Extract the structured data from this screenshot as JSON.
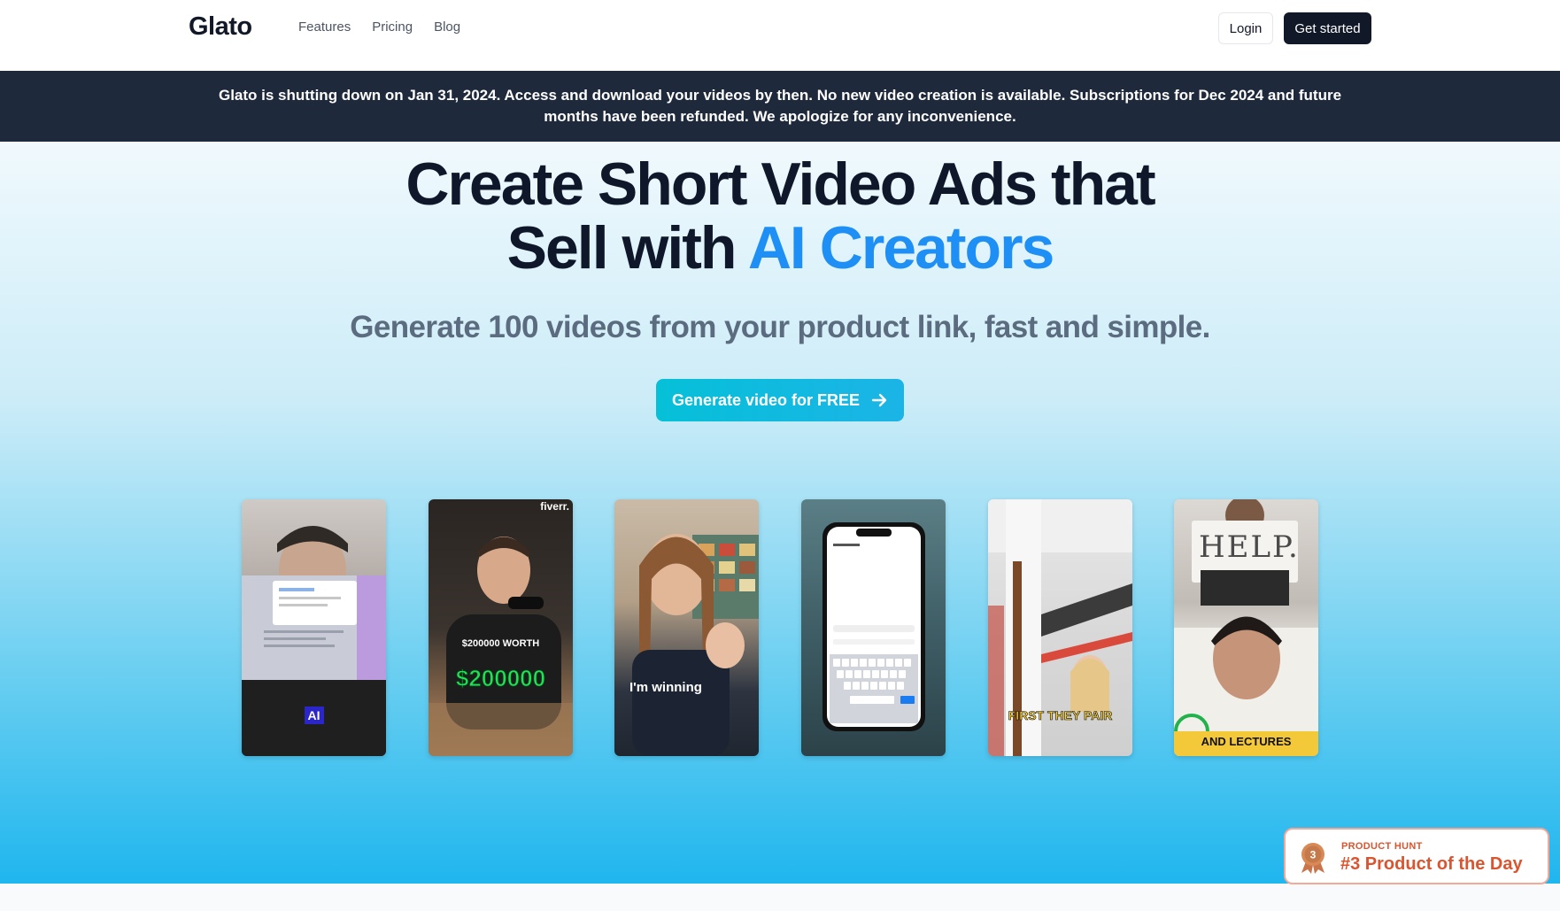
{
  "nav": {
    "logo": "Glato",
    "links": [
      "Features",
      "Pricing",
      "Blog"
    ],
    "login_label": "Login",
    "get_started_label": "Get started"
  },
  "banner": {
    "text": "Glato is shutting down on Jan 31, 2024. Access and download your videos by then. No new video creation is available. Subscriptions for Dec 2024 and future months have been refunded. We apologize for any inconvenience."
  },
  "hero": {
    "title_line1": "Create Short Video Ads that",
    "title_line2_plain": "Sell with ",
    "title_line2_accent": "AI Creators",
    "subtitle": "Generate 100 videos from your product link, fast and simple.",
    "cta_label": "Generate video for FREE",
    "accent_color": "#1d8ff5"
  },
  "videos": [
    {
      "caption": "AI"
    },
    {
      "caption_top": "$200000 WORTH",
      "caption": "$200000",
      "watermark": "fiverr."
    },
    {
      "caption": "I'm winning"
    },
    {
      "caption": ""
    },
    {
      "caption": "FIRST THEY PAIR"
    },
    {
      "caption": "AND LECTURES",
      "sign_text": "HELP."
    }
  ],
  "product_hunt": {
    "label": "PRODUCT HUNT",
    "title": "#3 Product of the Day",
    "rank": "3",
    "color": "#da552f"
  }
}
